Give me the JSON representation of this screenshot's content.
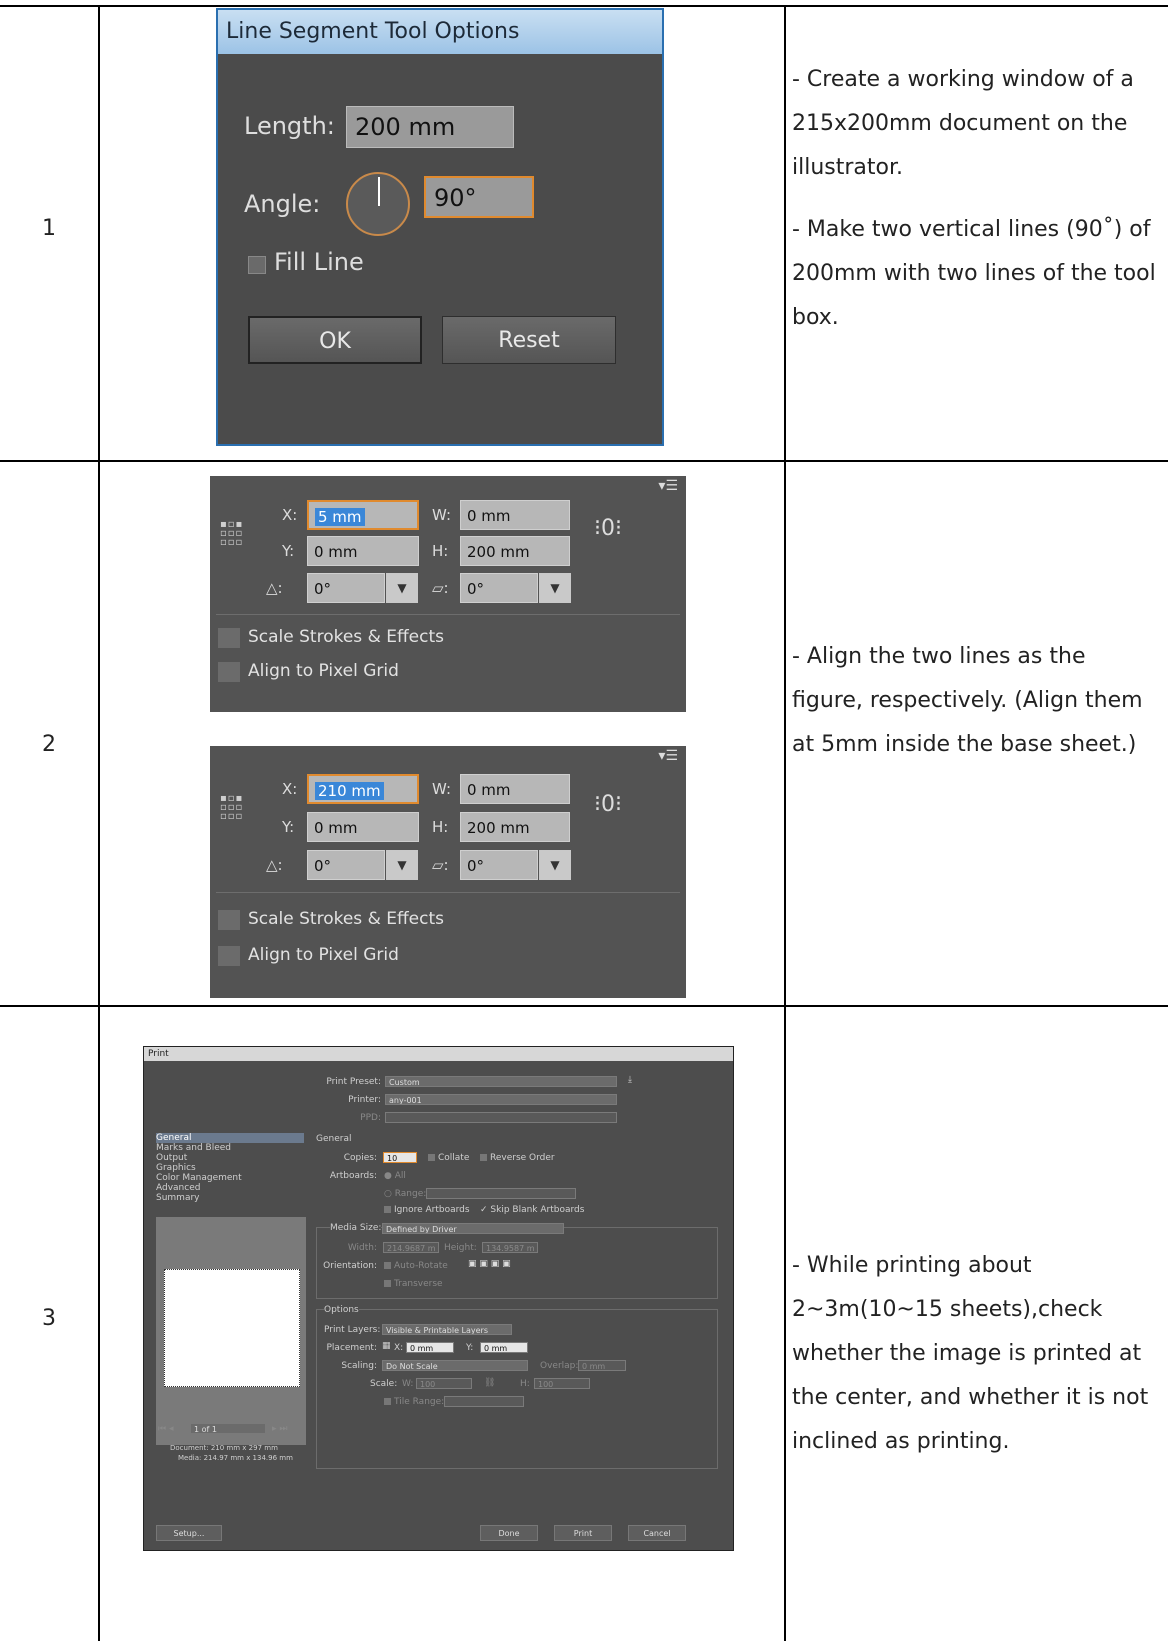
{
  "rows": [
    {
      "number": "1",
      "description": [
        "- Create a working window of a 215x200mm document on the illustrator.",
        "- Make two vertical lines (90˚) of 200mm with two lines of the tool box."
      ]
    },
    {
      "number": "2",
      "description": [
        "- Align the two lines as the figure, respectively. (Align them at 5mm inside the base sheet.)"
      ]
    },
    {
      "number": "3",
      "description": [
        "- While printing about 2~3m(10~15 sheets),check whether the image is printed at the center, and whether it is not inclined as printing."
      ]
    }
  ],
  "line_dialog": {
    "title": "Line Segment Tool Options",
    "length_label": "Length:",
    "length_value": "200 mm",
    "angle_label": "Angle:",
    "angle_value": "90°",
    "fill_line_label": "Fill Line",
    "ok_label": "OK",
    "reset_label": "Reset"
  },
  "transform_panels": [
    {
      "x": "5 mm",
      "y": "0 mm",
      "w": "0 mm",
      "h": "200 mm",
      "rotate": "0°",
      "shear": "0°",
      "scale_strokes": "Scale Strokes & Effects",
      "align_pixel": "Align to Pixel Grid"
    },
    {
      "x": "210 mm",
      "y": "0 mm",
      "w": "0 mm",
      "h": "200 mm",
      "rotate": "0°",
      "shear": "0°",
      "scale_strokes": "Scale Strokes & Effects",
      "align_pixel": "Align to Pixel Grid"
    }
  ],
  "transform_labels": {
    "x": "X:",
    "y": "Y:",
    "w": "W:",
    "h": "H:",
    "rotate": ":",
    "shear": ":"
  },
  "print_dialog": {
    "title": "Print",
    "preset_label": "Print Preset:",
    "preset_value": "Custom",
    "printer_label": "Printer:",
    "printer_value": "any-001",
    "ppd_label": "PPD:",
    "sidebar": [
      "General",
      "Marks and Bleed",
      "Output",
      "Graphics",
      "Color Management",
      "Advanced",
      "Summary"
    ],
    "section_general": "General",
    "copies_label": "Copies:",
    "copies_value": "10",
    "collate_label": "Collate",
    "reverse_label": "Reverse Order",
    "artboards_label": "Artboards:",
    "all_label": "All",
    "range_label": "Range:",
    "ignore_label": "Ignore Artboards",
    "skip_label": "Skip Blank Artboards",
    "media_size_label": "Media Size:",
    "media_size_value": "Defined by Driver",
    "width_label": "Width:",
    "width_value": "214.9687 m",
    "height_label": "Height:",
    "height_value": "134.9587 m",
    "orientation_label": "Orientation:",
    "auto_rotate_label": "Auto-Rotate",
    "transverse_label": "Transverse",
    "options_label": "Options",
    "print_layers_label": "Print Layers:",
    "print_layers_value": "Visible & Printable Layers",
    "placement_label": "Placement:",
    "px_label": "X:",
    "px_value": "0 mm",
    "py_label": "Y:",
    "py_value": "0 mm",
    "scaling_label": "Scaling:",
    "scaling_value": "Do Not Scale",
    "overlap_label": "Overlap:",
    "overlap_value": "0 mm",
    "scale_label": "Scale:",
    "sw_label": "W:",
    "sw_value": "100",
    "sh_label": "H:",
    "sh_value": "100",
    "tile_label": "Tile Range:",
    "page_nav": "1 of 1",
    "document_info": "Document: 210 mm x 297 mm",
    "media_info": "Media: 214.97 mm x 134.96 mm",
    "setup_label": "Setup...",
    "done_label": "Done",
    "print_label": "Print",
    "cancel_label": "Cancel"
  }
}
